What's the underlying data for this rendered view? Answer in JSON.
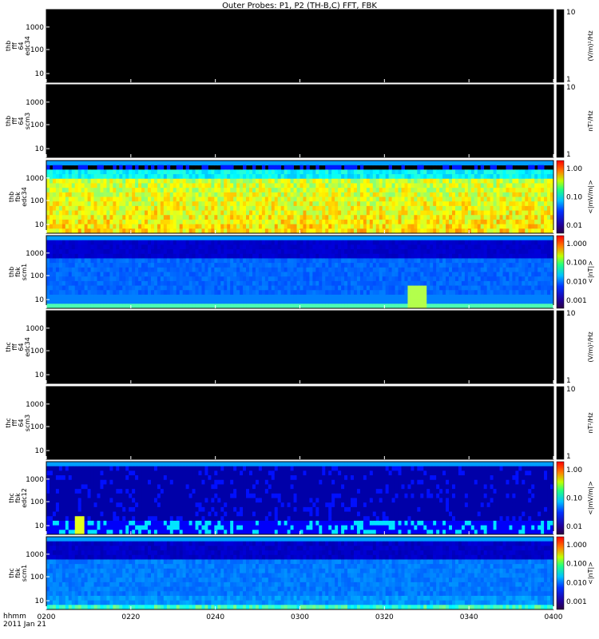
{
  "chart_data": {
    "type": "heatmap",
    "title": "Outer Probes: P1, P2 (TH-B,C) FFT, FBK",
    "x_axis": {
      "tick_labels": [
        "0200",
        "0220",
        "0240",
        "0300",
        "0320",
        "0340",
        "0400"
      ],
      "corner_label": "hhmm",
      "date_label": "2011 Jan 21"
    },
    "panels": [
      {
        "label": [
          "thb",
          "fff",
          "64",
          "edc34"
        ],
        "kind": "empty",
        "yticks": [
          "1000",
          "100",
          "10"
        ],
        "cb_unit": "(V/m)²/Hz",
        "cb_ticks": [
          "10",
          "1"
        ]
      },
      {
        "label": [
          "thb",
          "fff",
          "64",
          "scm3"
        ],
        "kind": "empty",
        "yticks": [
          "1000",
          "100",
          "10"
        ],
        "cb_unit": "nT²/Hz",
        "cb_ticks": [
          "10",
          "1"
        ]
      },
      {
        "label": [
          "thb",
          "fbk",
          "edc34"
        ],
        "kind": "fbk_e_active",
        "yticks": [
          "1000",
          "100",
          "10"
        ],
        "cb_unit": "<|mV/m|>",
        "cb_ticks": [
          "1.00",
          "0.10",
          "0.01"
        ]
      },
      {
        "label": [
          "thb",
          "fbk",
          "scm1"
        ],
        "kind": "fbk_b_thb",
        "yticks": [
          "1000",
          "100",
          "10"
        ],
        "cb_unit": "<|nT|>",
        "cb_ticks": [
          "1.000",
          "0.100",
          "0.010",
          "0.001"
        ]
      },
      {
        "label": [
          "thc",
          "fff",
          "64",
          "edc34"
        ],
        "kind": "empty",
        "yticks": [
          "1000",
          "100",
          "10"
        ],
        "cb_unit": "(V/m)²/Hz",
        "cb_ticks": [
          "10",
          "1"
        ]
      },
      {
        "label": [
          "thc",
          "fff",
          "64",
          "scm3"
        ],
        "kind": "empty",
        "yticks": [
          "1000",
          "100",
          "10"
        ],
        "cb_unit": "nT²/Hz",
        "cb_ticks": [
          "10",
          "1"
        ]
      },
      {
        "label": [
          "thc",
          "fbk",
          "edc12"
        ],
        "kind": "fbk_e_quiet",
        "yticks": [
          "1000",
          "100",
          "10"
        ],
        "cb_unit": "<|mV/m|>",
        "cb_ticks": [
          "1.00",
          "0.10",
          "0.01"
        ]
      },
      {
        "label": [
          "thc",
          "fbk",
          "scm1"
        ],
        "kind": "fbk_b_thc",
        "yticks": [
          "1000",
          "100",
          "10"
        ],
        "cb_unit": "<|nT|>",
        "cb_ticks": [
          "1.000",
          "0.100",
          "0.010",
          "0.001"
        ]
      }
    ]
  }
}
